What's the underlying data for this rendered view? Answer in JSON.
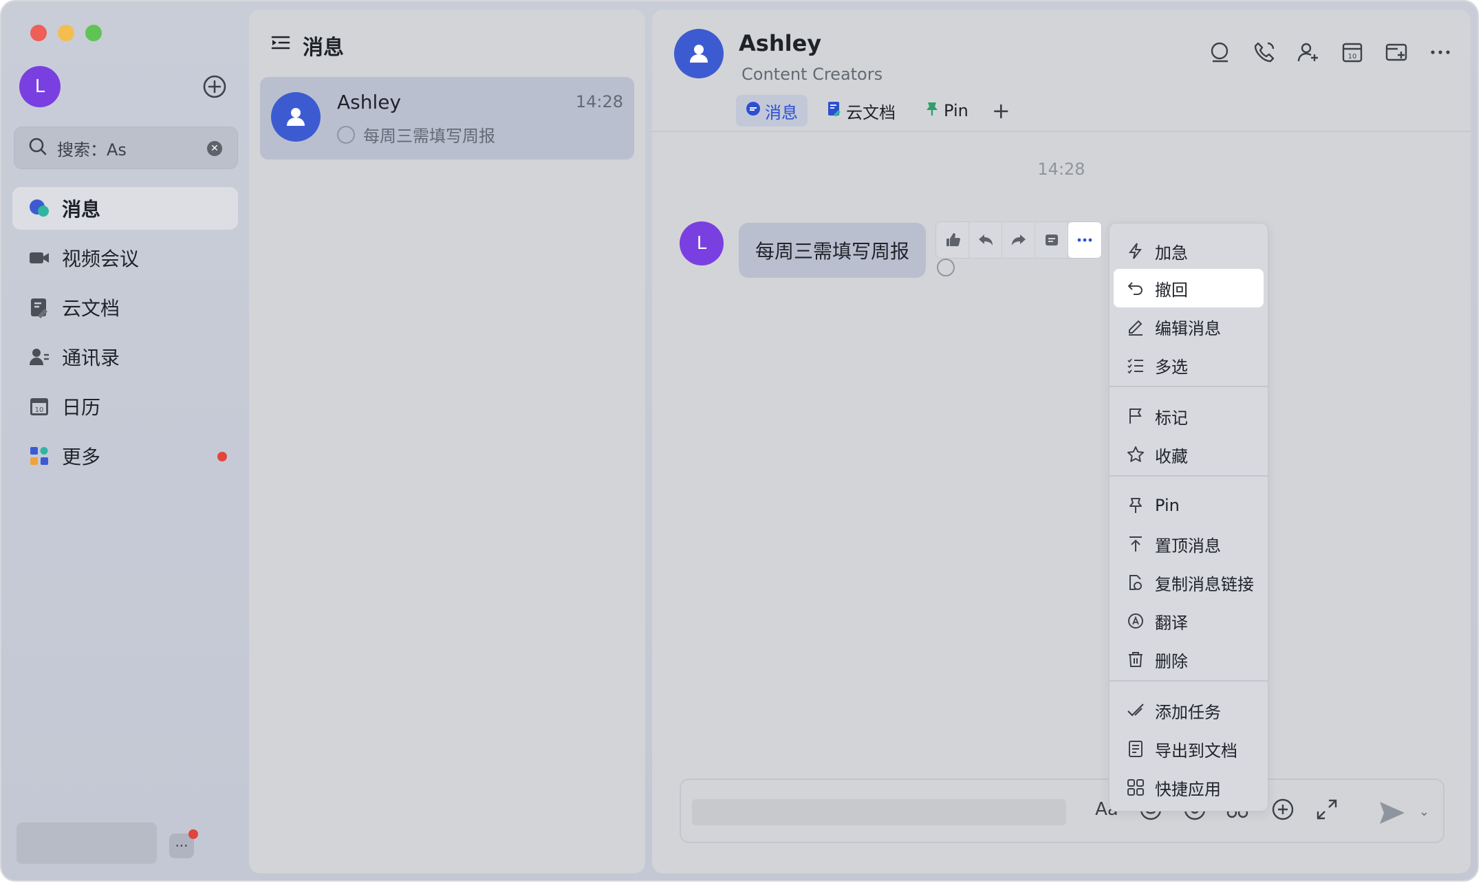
{
  "window": {
    "traffic_lights": [
      "close",
      "minimize",
      "zoom"
    ]
  },
  "sidebar": {
    "user_initial": "L",
    "search_text": "搜索：As",
    "items": [
      {
        "label": "消息",
        "icon": "chat-bubble-icon",
        "active": true
      },
      {
        "label": "视频会议",
        "icon": "video-camera-icon"
      },
      {
        "label": "云文档",
        "icon": "document-icon"
      },
      {
        "label": "通讯录",
        "icon": "contacts-icon"
      },
      {
        "label": "日历",
        "icon": "calendar-icon"
      },
      {
        "label": "更多",
        "icon": "apps-grid-icon",
        "badge": true
      }
    ],
    "more_label": "···"
  },
  "list": {
    "title": "消息",
    "chats": [
      {
        "name": "Ashley",
        "time": "14:28",
        "preview": "每周三需填写周报"
      }
    ]
  },
  "chat": {
    "name": "Ashley",
    "subtitle": "Content Creators",
    "tabs": [
      {
        "label": "消息",
        "active": true
      },
      {
        "label": "云文档"
      },
      {
        "label": "Pin"
      }
    ],
    "tab_add": "+",
    "time_divider": "14:28",
    "message": {
      "avatar_initial": "L",
      "text": "每周三需填写周报"
    }
  },
  "context_menu": {
    "items": [
      {
        "label": "加急",
        "icon": "lightning-icon"
      },
      {
        "label": "撤回",
        "icon": "undo-icon",
        "highlighted": true
      },
      {
        "label": "编辑消息",
        "icon": "pencil-icon"
      },
      {
        "label": "多选",
        "icon": "checklist-icon"
      },
      {
        "label": "标记",
        "icon": "flag-icon"
      },
      {
        "label": "收藏",
        "icon": "star-icon"
      },
      {
        "label": "Pin",
        "icon": "pin-icon"
      },
      {
        "label": "置顶消息",
        "icon": "pin-top-icon"
      },
      {
        "label": "复制消息链接",
        "icon": "link-icon"
      },
      {
        "label": "翻译",
        "icon": "translate-icon"
      },
      {
        "label": "删除",
        "icon": "trash-icon"
      },
      {
        "label": "添加任务",
        "icon": "task-check-icon"
      },
      {
        "label": "导出到文档",
        "icon": "export-doc-icon"
      },
      {
        "label": "快捷应用",
        "icon": "quick-apps-icon"
      }
    ]
  },
  "composer": {
    "format_label": "Aa"
  },
  "colors": {
    "accent": "#3d5bd1",
    "avatar_purple": "#7a3fe0",
    "badge_red": "#e0463c"
  }
}
